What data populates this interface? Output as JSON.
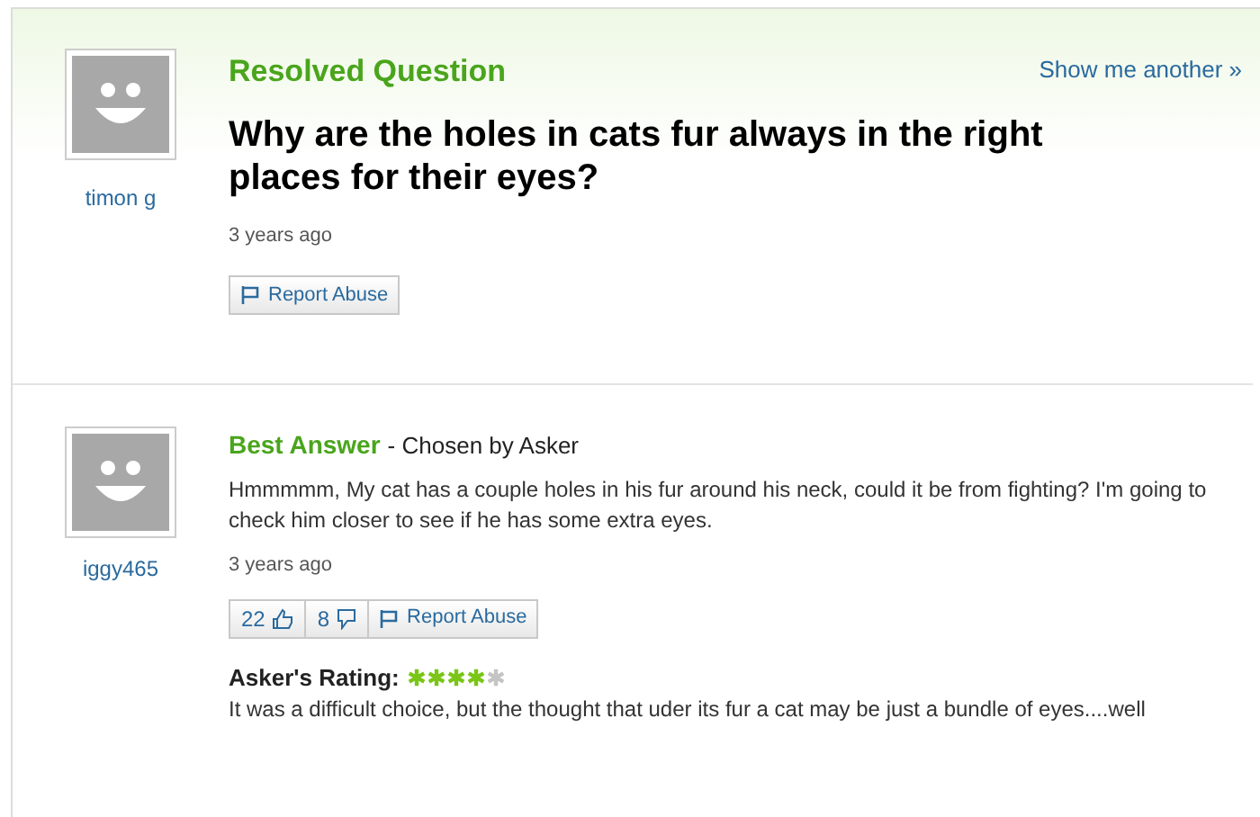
{
  "question": {
    "header": "Resolved Question",
    "show_another": "Show me another »",
    "user": "timon g",
    "title": "Why are the holes in cats fur always in the right places for their eyes?",
    "time": "3 years ago",
    "report": "Report Abuse"
  },
  "best_answer": {
    "header": "Best Answer",
    "chosen": "- Chosen by Asker",
    "user": "iggy465",
    "text": "Hmmmmm, My cat has a couple holes in his fur around his neck, could it be from fighting? I'm going to check him closer to see if he has some extra eyes.",
    "time": "3 years ago",
    "thumbs_up": "22",
    "thumbs_down": "8",
    "report": "Report Abuse",
    "rating_label": "Asker's Rating:",
    "stars": 4,
    "comment": "It was a difficult choice, but the thought that uder its fur a cat may be just a bundle of eyes....well"
  }
}
